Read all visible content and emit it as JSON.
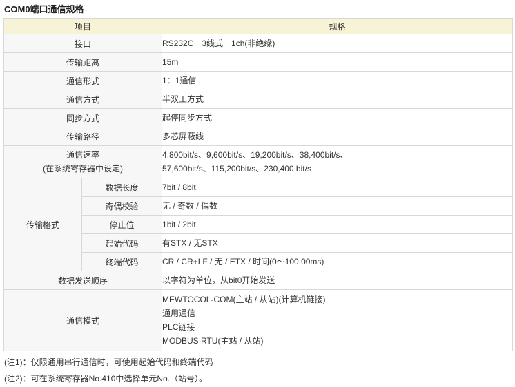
{
  "title": "COM0端口通信规格",
  "header": {
    "item": "项目",
    "spec": "规格"
  },
  "rows": {
    "interface": {
      "label": "接口",
      "value": "RS232C　3线式　1ch(非绝缘)"
    },
    "distance": {
      "label": "传输距离",
      "value": "15m"
    },
    "form": {
      "label": "通信形式",
      "value": "1：1通信"
    },
    "method": {
      "label": "通信方式",
      "value": "半双工方式"
    },
    "sync": {
      "label": "同步方式",
      "value": "起停同步方式"
    },
    "path": {
      "label": "传输路径",
      "value": "多芯屏蔽线"
    },
    "speed": {
      "label_line1": "通信速率",
      "label_line2": "(在系统寄存器中设定)",
      "value_line1": "4,800bit/s、9,600bit/s、19,200bit/s、38,400bit/s、",
      "value_line2": "57,600bit/s、115,200bit/s、230,400 bit/s"
    },
    "format": {
      "label": "传输格式",
      "sub": {
        "data_length": {
          "label": "数据长度",
          "value": "7bit / 8bit"
        },
        "parity": {
          "label": "奇偶校验",
          "value": "无 / 奇数 / 偶数"
        },
        "stop_bit": {
          "label": "停止位",
          "value": "1bit / 2bit"
        },
        "start_code": {
          "label": "起始代码",
          "value": "有STX / 无STX"
        },
        "end_code": {
          "label": "终端代码",
          "value": "CR / CR+LF / 无 / ETX / 时间(0～100.00ms)"
        }
      }
    },
    "order": {
      "label": "数据发送顺序",
      "value": "以字符为单位，从bit0开始发送"
    },
    "mode": {
      "label": "通信模式",
      "lines": [
        "MEWTOCOL-COM(主站 / 从站)(计算机链接)",
        "通用通信",
        "PLC链接",
        "MODBUS RTU(主站 / 从站)"
      ]
    }
  },
  "notes": [
    "(注1)：仅限通用串行通信时，可使用起始代码和终端代码",
    "(注2)：可在系统寄存器No.410中选择单元No.（站号）。"
  ]
}
